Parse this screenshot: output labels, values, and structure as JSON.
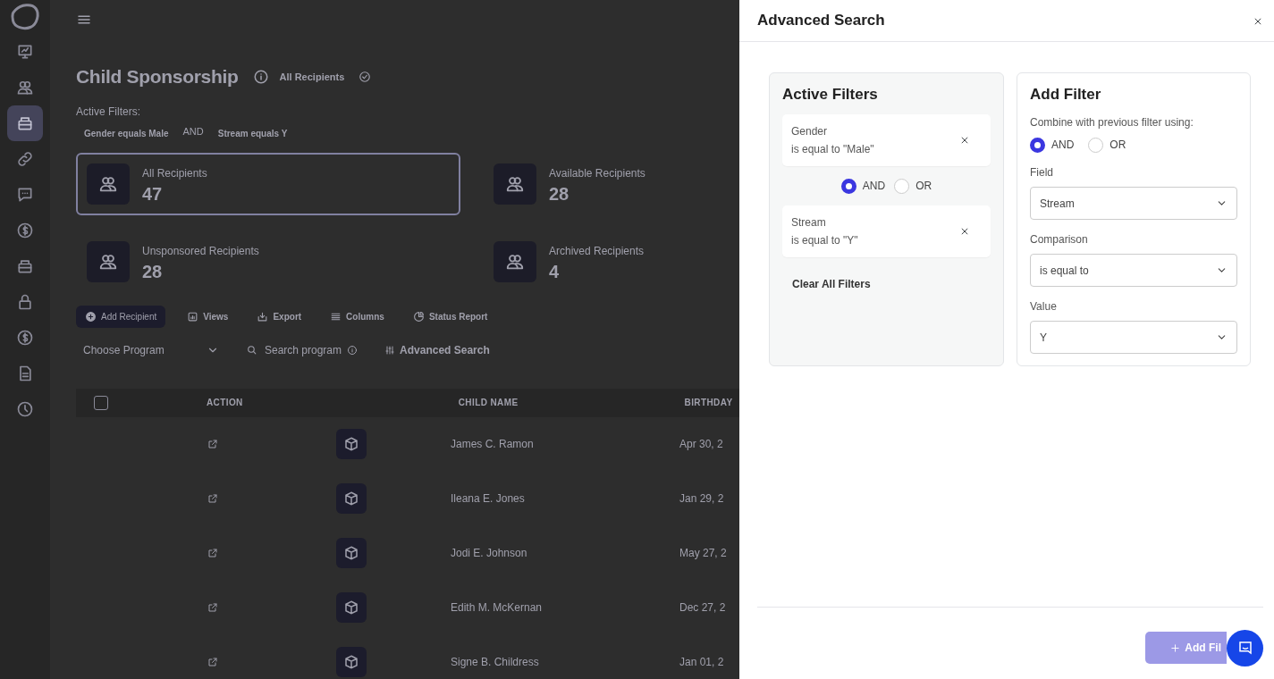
{
  "sidebar": {
    "items": [
      {
        "selected": false
      },
      {
        "selected": false
      },
      {
        "selected": true
      },
      {
        "selected": false
      },
      {
        "selected": false
      },
      {
        "selected": false
      },
      {
        "selected": false
      },
      {
        "selected": false
      },
      {
        "selected": false
      },
      {
        "selected": false
      },
      {
        "selected": false
      }
    ]
  },
  "page": {
    "title": "Child Sponsorship",
    "view": "All Recipients",
    "active_filters_label": "Active Filters:",
    "filter_chips": [
      {
        "kind": "chip",
        "label": "Gender equals Male"
      },
      {
        "kind": "connector",
        "label": "AND"
      },
      {
        "kind": "chip",
        "label": "Stream equals Y"
      }
    ],
    "stats": [
      {
        "label": "All Recipients",
        "count": "47",
        "selected": true
      },
      {
        "label": "Available Recipients",
        "count": "28",
        "selected": false
      },
      {
        "label": "Unsponsored Recipients",
        "count": "28",
        "selected": false
      },
      {
        "label": "Archived Recipients",
        "count": "4",
        "selected": false
      }
    ],
    "toolbar": [
      {
        "kind": "primary",
        "label": "Add Recipient"
      },
      {
        "kind": "views",
        "label": "Views"
      },
      {
        "kind": "export",
        "label": "Export"
      },
      {
        "kind": "columns",
        "label": "Columns"
      },
      {
        "kind": "report",
        "label": "Status Report"
      }
    ],
    "program_select": {
      "placeholder": "Choose Program"
    },
    "search": {
      "placeholder": "Search program"
    },
    "advanced_search": "Advanced Search",
    "table": {
      "select_all": {
        "checked": false
      },
      "columns": [
        "ACTION",
        "CHILD NAME",
        "BIRTHDAY"
      ],
      "rows": [
        {
          "name": "James C. Ramon",
          "birthday": "Apr 30, 2"
        },
        {
          "name": "Ileana E. Jones",
          "birthday": "Jan 29, 2"
        },
        {
          "name": "Jodi E. Johnson",
          "birthday": "May 27, 2"
        },
        {
          "name": "Edith M. McKernan",
          "birthday": "Dec 27, 2"
        },
        {
          "name": "Signe B. Childress",
          "birthday": "Jan 01, 2"
        }
      ]
    }
  },
  "drawer": {
    "title": "Advanced Search",
    "active_filters": {
      "title": "Active Filters",
      "items": [
        {
          "kind": "filter",
          "field": "Gender",
          "condition": "is equal to \"Male\""
        },
        {
          "kind": "connector",
          "options": [
            {
              "label": "AND",
              "selected": true
            },
            {
              "label": "OR",
              "selected": false
            }
          ]
        },
        {
          "kind": "filter",
          "field": "Stream",
          "condition": "is equal to \"Y\""
        }
      ],
      "clear_label": "Clear All Filters"
    },
    "add_filter": {
      "title": "Add Filter",
      "combine_label": "Combine with previous filter using:",
      "combine_options": [
        {
          "label": "AND",
          "selected": true
        },
        {
          "label": "OR",
          "selected": false
        }
      ],
      "fields": [
        {
          "label": "Field",
          "value": "Stream"
        },
        {
          "label": "Comparison",
          "value": "is equal to"
        },
        {
          "label": "Value",
          "value": "Y"
        }
      ]
    },
    "submit": {
      "label": "Add Fil",
      "disabled": true
    }
  }
}
